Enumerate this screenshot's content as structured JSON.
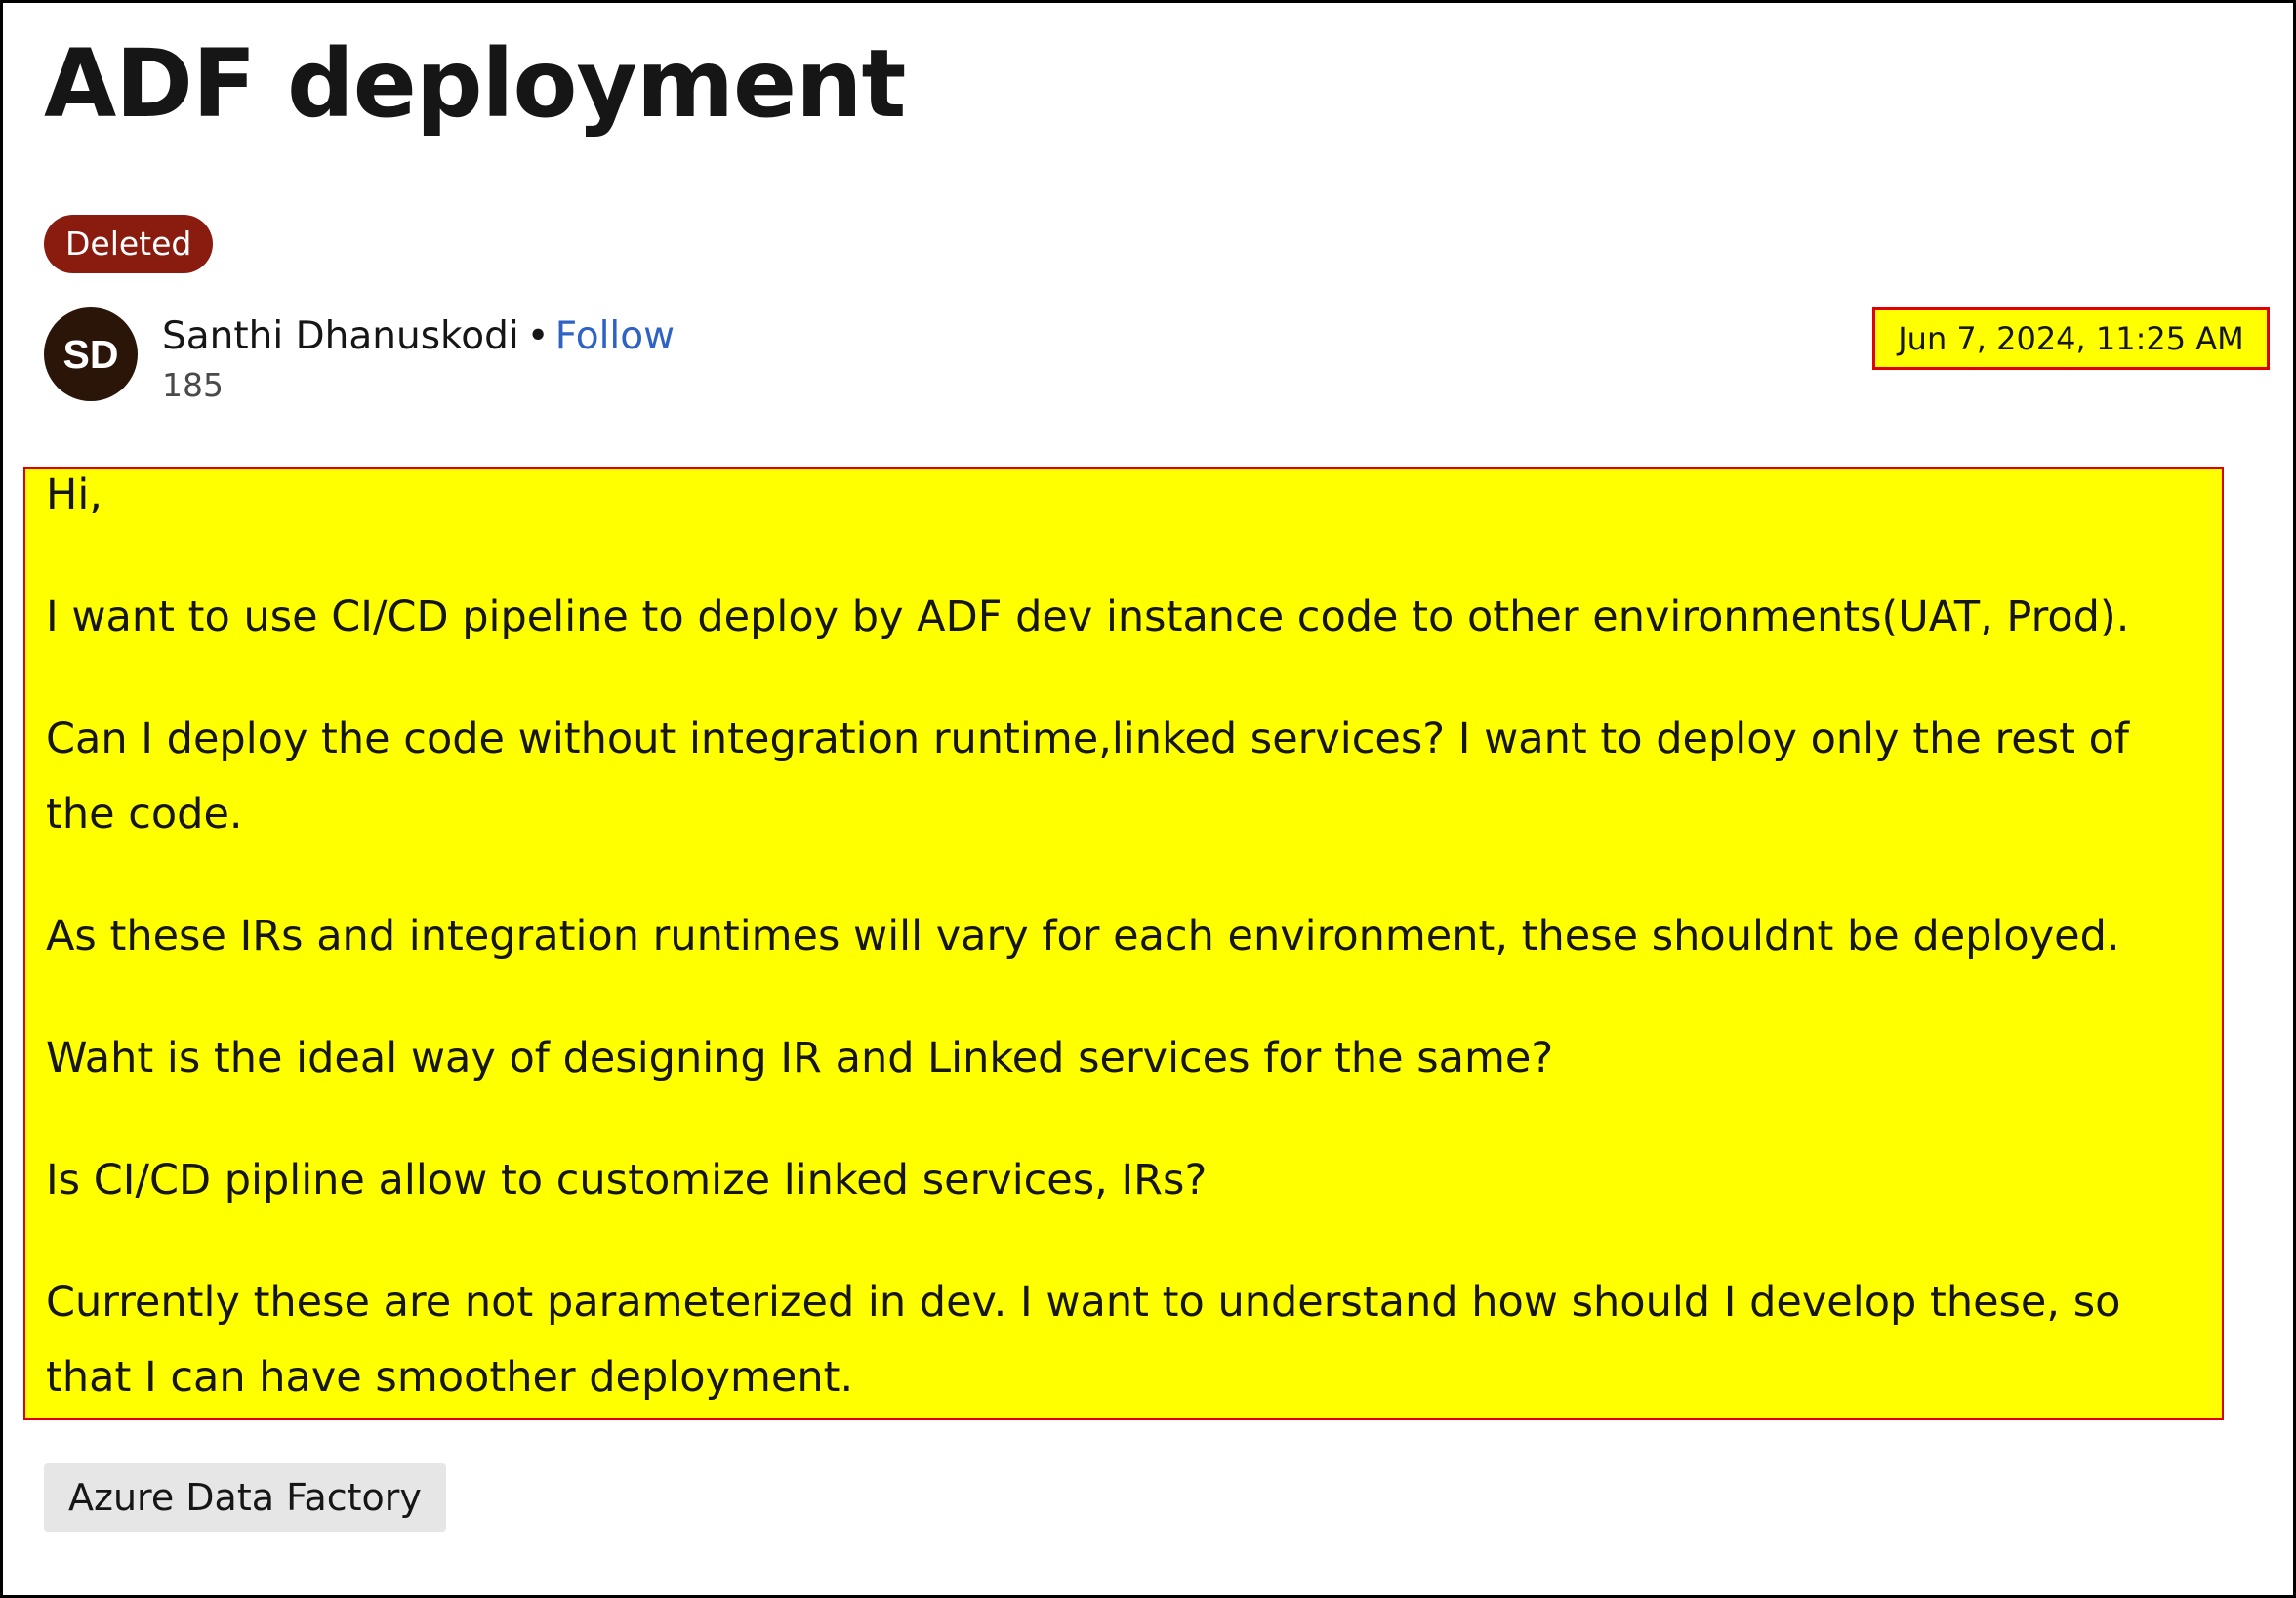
{
  "question": {
    "title": "ADF deployment",
    "status_badge": "Deleted",
    "author": {
      "initials": "SD",
      "name": "Santhi Dhanuskodi",
      "separator": "•",
      "follow_label": "Follow",
      "points": "185"
    },
    "timestamp": "Jun 7, 2024, 11:25 AM",
    "body_paragraphs": [
      "Hi,",
      "I want to use CI/CD pipeline to deploy by ADF dev instance code to other environments(UAT, Prod).",
      "Can I deploy the code without integration runtime,linked services? I want to deploy only the rest of the code.",
      "As these IRs and integration runtimes will vary for each environment, these shouldnt be deployed.",
      "Waht is the ideal way of designing IR and Linked services for the same?",
      "Is CI/CD pipline allow to customize linked services, IRs?",
      "Currently these are not parameterized in dev. I want to understand how should I develop these, so that I can have smoother deployment."
    ],
    "tags": [
      "Azure Data Factory"
    ]
  },
  "colors": {
    "badge_background": "#8a1b0f",
    "follow_link": "#2e62c3",
    "highlight_fill": "#ffff00",
    "highlight_border": "#e00000",
    "avatar_background": "#2b1509",
    "tag_background": "#e6e6e6"
  }
}
